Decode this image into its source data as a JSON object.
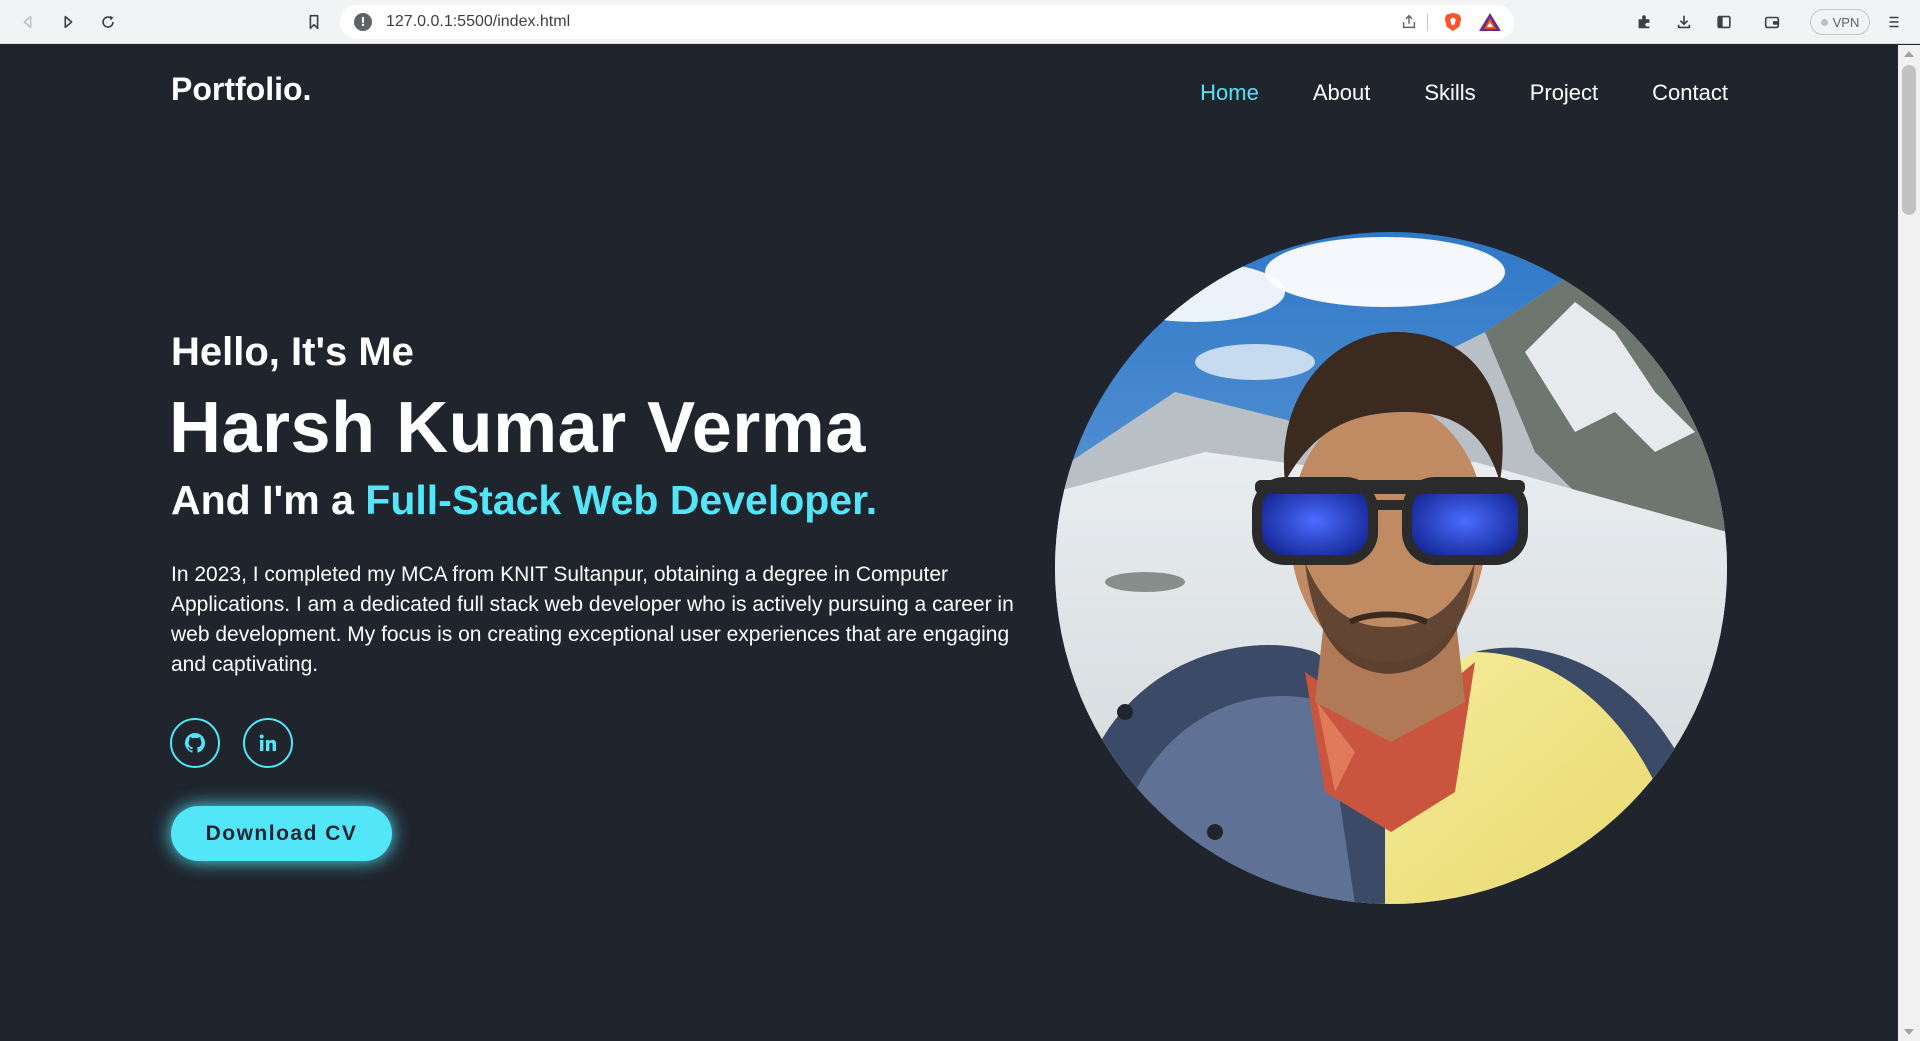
{
  "browser": {
    "url": "127.0.0.1:5500/index.html",
    "vpn_label": "VPN"
  },
  "page": {
    "logo": "Portfolio.",
    "nav": [
      "Home",
      "About",
      "Skills",
      "Project",
      "Contact"
    ],
    "active_nav": "Home",
    "hello": "Hello, It's Me",
    "name": "Harsh Kumar Verma",
    "role_prefix": "And I'm a",
    "role_accent": "Full-Stack Web Developer.",
    "bio": "In 2023, I completed my MCA from KNIT Sultanpur, obtaining a degree in Computer Applications. I am a dedicated full stack web developer who is actively pursuing a career in web development. My focus is on creating exceptional user experiences that are engaging and captivating.",
    "social": [
      {
        "icon": "github-icon"
      },
      {
        "icon": "linkedin-icon"
      }
    ],
    "cv_button": "Download CV"
  },
  "colors": {
    "background": "#1f242d",
    "accent": "#53e6f8",
    "text": "#ffffff"
  }
}
